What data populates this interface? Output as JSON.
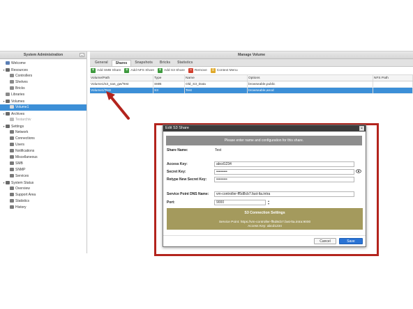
{
  "left_panel": {
    "title": "System Administration",
    "collapse": "«",
    "tree": [
      {
        "label": "Welcome",
        "level": 0,
        "toggle": "",
        "icon_color": "#5b7fb5",
        "state": ""
      },
      {
        "label": "Resources",
        "level": 0,
        "toggle": "▾",
        "icon_color": "#6a6a6a",
        "state": ""
      },
      {
        "label": "Controllers",
        "level": 1,
        "toggle": "",
        "icon_color": "#8a8a8a",
        "state": ""
      },
      {
        "label": "Shelves",
        "level": 1,
        "toggle": "",
        "icon_color": "#8a8a8a",
        "state": ""
      },
      {
        "label": "Bricks",
        "level": 1,
        "toggle": "",
        "icon_color": "#8a8a8a",
        "state": ""
      },
      {
        "label": "Libraries",
        "level": 0,
        "toggle": "",
        "icon_color": "#8a8a8a",
        "state": ""
      },
      {
        "label": "Volumes",
        "level": 0,
        "toggle": "▾",
        "icon_color": "#6a6a6a",
        "state": ""
      },
      {
        "label": "Volume1",
        "level": 1,
        "toggle": "",
        "icon_color": "#d9d9d9",
        "state": "selected"
      },
      {
        "label": "Archives",
        "level": 0,
        "toggle": "▾",
        "icon_color": "#6a6a6a",
        "state": ""
      },
      {
        "label": "Testarchiv",
        "level": 1,
        "toggle": "",
        "icon_color": "#bbbbbb",
        "state": "dim"
      },
      {
        "label": "Settings",
        "level": 0,
        "toggle": "▾",
        "icon_color": "#6a6a6a",
        "state": ""
      },
      {
        "label": "Network",
        "level": 1,
        "toggle": "",
        "icon_color": "#7a7a7a",
        "state": ""
      },
      {
        "label": "Connections",
        "level": 1,
        "toggle": "",
        "icon_color": "#7a7a7a",
        "state": ""
      },
      {
        "label": "Users",
        "level": 1,
        "toggle": "",
        "icon_color": "#7a7a7a",
        "state": ""
      },
      {
        "label": "Notifications",
        "level": 1,
        "toggle": "",
        "icon_color": "#7a7a7a",
        "state": ""
      },
      {
        "label": "Miscellaneous",
        "level": 1,
        "toggle": "",
        "icon_color": "#7a7a7a",
        "state": ""
      },
      {
        "label": "SMB",
        "level": 1,
        "toggle": "",
        "icon_color": "#7a7a7a",
        "state": ""
      },
      {
        "label": "SNMP",
        "level": 1,
        "toggle": "",
        "icon_color": "#7a7a7a",
        "state": ""
      },
      {
        "label": "Services",
        "level": 1,
        "toggle": "",
        "icon_color": "#7a7a7a",
        "state": ""
      },
      {
        "label": "System Status",
        "level": 0,
        "toggle": "▾",
        "icon_color": "#6a6a6a",
        "state": ""
      },
      {
        "label": "Overview",
        "level": 1,
        "toggle": "",
        "icon_color": "#7a7a7a",
        "state": ""
      },
      {
        "label": "Support Area",
        "level": 1,
        "toggle": "",
        "icon_color": "#7a7a7a",
        "state": ""
      },
      {
        "label": "Statistics",
        "level": 1,
        "toggle": "",
        "icon_color": "#7a7a7a",
        "state": ""
      },
      {
        "label": "History",
        "level": 1,
        "toggle": "",
        "icon_color": "#7a7a7a",
        "state": ""
      }
    ]
  },
  "right_panel": {
    "title": "Manage Volume",
    "tabs": [
      {
        "label": "General",
        "active": false
      },
      {
        "label": "Shares",
        "active": true
      },
      {
        "label": "Snapshots",
        "active": false
      },
      {
        "label": "Bricks",
        "active": false
      },
      {
        "label": "Statistics",
        "active": false
      }
    ],
    "toolbar": [
      {
        "label": "Add SMB Share",
        "icon": "add-icon",
        "color": "#3f9a3f",
        "glyph": "+"
      },
      {
        "label": "Add NFS Share",
        "icon": "add-icon",
        "color": "#3f9a3f",
        "glyph": "+"
      },
      {
        "label": "Add S3 Share",
        "icon": "add-icon",
        "color": "#3f9a3f",
        "glyph": "+"
      },
      {
        "label": "Remove",
        "icon": "remove-icon",
        "color": "#d2412f",
        "glyph": "−"
      },
      {
        "label": "Context Menu",
        "icon": "context-menu-icon",
        "color": "#e0a92a",
        "glyph": "≡"
      }
    ],
    "columns": [
      "Volume/Path",
      "Type",
      "Name",
      "Options",
      "NFS Path"
    ],
    "rows": [
      {
        "path": "Volume1/s3_nas_gw/Test",
        "type": "SMB",
        "name": "Old_S3_Data",
        "options": "browseable,public",
        "nfs": "",
        "selected": false
      },
      {
        "path": "Volume1/Test",
        "type": "S3",
        "name": "Test",
        "options": "browseable,anod",
        "nfs": "",
        "selected": true
      }
    ]
  },
  "dialog": {
    "title": "Edit S3 Share",
    "close": "✕",
    "banner": "Please enter name and configuration for this share.",
    "share_name_label": "Share Name:",
    "share_name_value": "Test",
    "access_key_label": "Access Key:",
    "access_key_value": "abcd1234",
    "secret_key_label": "Secret Key:",
    "secret_key_value": "•••••••••",
    "retype_label": "Retype New Secret Key:",
    "retype_value": "•••••••••",
    "dns_label": "Service Point DNS Name:",
    "dns_value": "vm-controller-ff5d8cb7.fast-lta.intra",
    "port_label": "Port:",
    "port_value": "9000",
    "s3_title": "S3 Connection Settings",
    "s3_service_point": "Service Point: https://vm-controller-ff5d8cb7.fast-lta.intra:9000",
    "s3_access_key": "Access Key: abcd1234",
    "cancel_label": "Cancel",
    "save_label": "Save",
    "accent_color": "#b3241d"
  }
}
